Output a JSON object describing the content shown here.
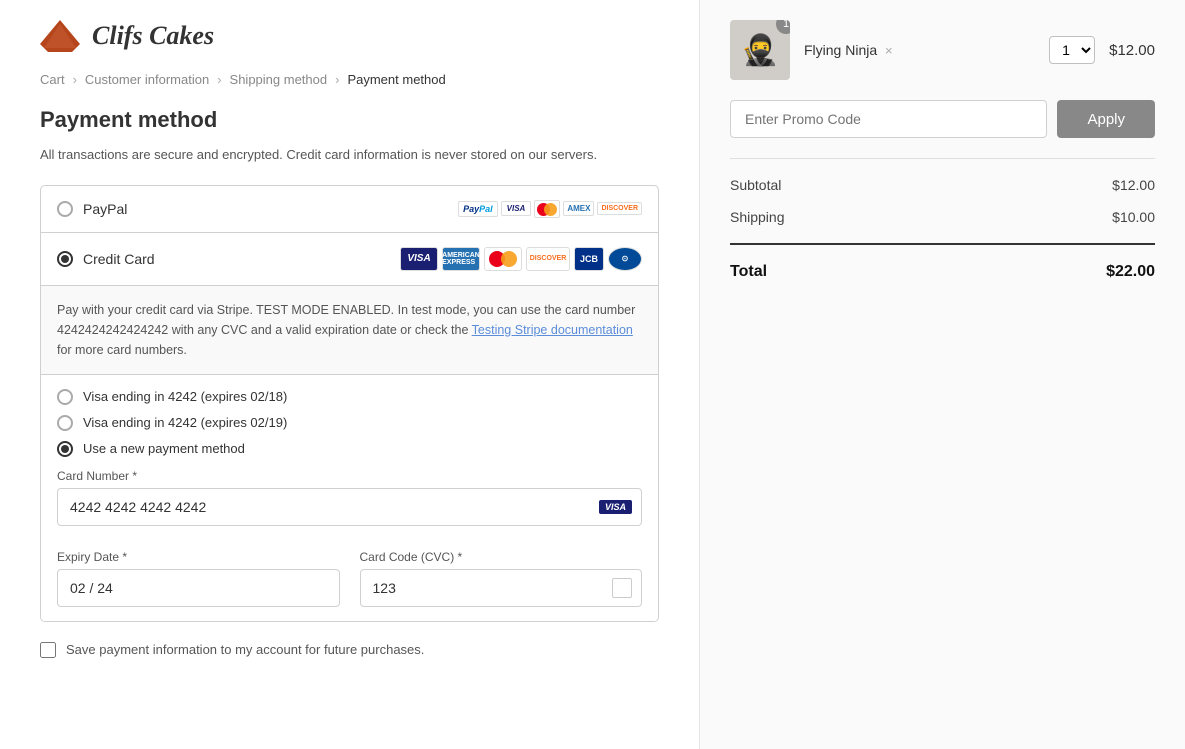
{
  "logo": {
    "text": "Clifs Cakes"
  },
  "breadcrumb": {
    "cart": "Cart",
    "customer": "Customer information",
    "shipping": "Shipping method",
    "payment": "Payment method"
  },
  "page": {
    "title": "Payment method",
    "security_text": "All transactions are secure and encrypted. Credit card information is never stored on our servers."
  },
  "payment_methods": {
    "paypal_label": "PayPal",
    "credit_card_label": "Credit Card"
  },
  "test_mode": {
    "text1": "Pay with your credit card via Stripe. TEST MODE ENABLED. In test mode, you can use the card number 4242424242424242 with any CVC and a valid expiration date or check the ",
    "link_text": "Testing Stripe documentation",
    "text2": " for more card numbers."
  },
  "saved_cards": {
    "visa_4242_18": "Visa ending in 4242 (expires 02/18)",
    "visa_4242_19": "Visa ending in 4242 (expires 02/19)",
    "new_method": "Use a new payment method"
  },
  "card_form": {
    "card_number_label": "Card Number *",
    "card_number_value": "4242 4242 4242 4242",
    "expiry_label": "Expiry Date *",
    "expiry_value": "02 / 24",
    "cvc_label": "Card Code (CVC) *",
    "cvc_value": "123"
  },
  "save_label": "Save payment information to my account for future purchases.",
  "order": {
    "product_name": "Flying Ninja",
    "product_remove": "×",
    "quantity": "1",
    "price": "$12.00"
  },
  "promo": {
    "placeholder": "Enter Promo Code",
    "apply_label": "Apply"
  },
  "summary": {
    "subtotal_label": "Subtotal",
    "subtotal_value": "$12.00",
    "shipping_label": "Shipping",
    "shipping_value": "$10.00",
    "total_label": "Total",
    "total_value": "$22.00"
  }
}
